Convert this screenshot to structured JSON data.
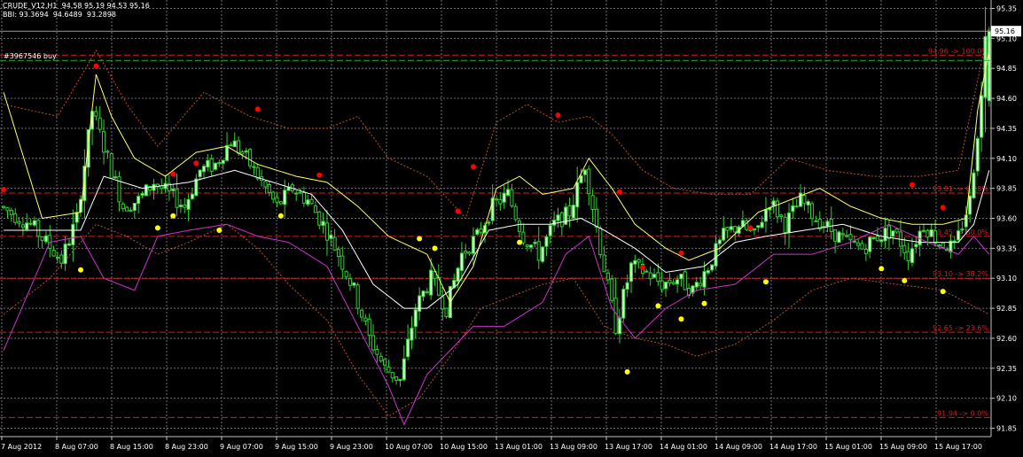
{
  "header": {
    "symbol_line": "CRUDE_V12,H1  94.58 95.19 94.53 95.16",
    "indicator_line": "BBI: 93.3694  94.6489  93.2898"
  },
  "order_label": "#3967546 buy",
  "current_price_label": "95.16",
  "colors": {
    "background": "#000000",
    "grid": "#707070",
    "candle": "#33cc33",
    "bull_fill": "#ccffcc",
    "fast_ma": "#ffff66",
    "slow_ma": "#ffffff",
    "lower_line": "#cc33cc",
    "envelope": "#b8502a",
    "fibo": "#cc2222",
    "peak_dot": "#ff0000",
    "trough_dot": "#ffff00"
  },
  "chart_data": {
    "type": "candlestick",
    "title": "CRUDE_V12,H1",
    "timeframe": "H1",
    "ylim": [
      91.78,
      95.42
    ],
    "y_ticks": [
      "95.35",
      "95.10",
      "94.85",
      "94.60",
      "94.35",
      "94.10",
      "93.85",
      "93.60",
      "93.35",
      "93.10",
      "92.85",
      "92.60",
      "92.35",
      "92.10",
      "91.85"
    ],
    "x_ticks": [
      "7 Aug 2012",
      "8 Aug 07:00",
      "8 Aug 15:00",
      "8 Aug 23:00",
      "9 Aug 07:00",
      "9 Aug 15:00",
      "9 Aug 23:00",
      "10 Aug 07:00",
      "10 Aug 15:00",
      "13 Aug 01:00",
      "13 Aug 09:00",
      "13 Aug 17:00",
      "14 Aug 01:00",
      "14 Aug 09:00",
      "14 Aug 17:00",
      "15 Aug 01:00",
      "15 Aug 09:00",
      "15 Aug 17:00"
    ],
    "last_ohlc": {
      "open": 94.58,
      "high": 95.19,
      "low": 94.53,
      "close": 95.16
    },
    "bbi": [
      93.3694,
      94.6489,
      93.2898
    ],
    "fibo_levels": [
      {
        "label": "94.96 -> 100.0%",
        "price": 94.96
      },
      {
        "label": "93.81 -> 61.8%",
        "price": 93.81
      },
      {
        "label": "93.45 -> 50.0%",
        "price": 93.45
      },
      {
        "label": "93.10 -> 38.2%",
        "price": 93.1
      },
      {
        "label": "92.65 -> 23.6%",
        "price": 92.65
      },
      {
        "label": "91.94 -> 0.0%",
        "price": 91.94
      }
    ],
    "candles_anchor": [
      [
        0,
        93.7
      ],
      [
        8,
        93.55
      ],
      [
        12,
        93.4
      ],
      [
        16,
        93.25
      ],
      [
        20,
        93.6
      ],
      [
        24,
        94.5
      ],
      [
        28,
        94.1
      ],
      [
        32,
        93.7
      ],
      [
        36,
        93.75
      ],
      [
        40,
        93.9
      ],
      [
        44,
        93.8
      ],
      [
        48,
        93.7
      ],
      [
        52,
        94.0
      ],
      [
        56,
        94.05
      ],
      [
        60,
        94.25
      ],
      [
        64,
        94.1
      ],
      [
        68,
        93.9
      ],
      [
        72,
        93.7
      ],
      [
        76,
        93.85
      ],
      [
        80,
        93.75
      ],
      [
        84,
        93.55
      ],
      [
        88,
        93.3
      ],
      [
        92,
        93.0
      ],
      [
        96,
        92.6
      ],
      [
        100,
        92.35
      ],
      [
        104,
        92.25
      ],
      [
        108,
        92.85
      ],
      [
        112,
        93.1
      ],
      [
        116,
        92.85
      ],
      [
        120,
        93.3
      ],
      [
        124,
        93.45
      ],
      [
        128,
        93.7
      ],
      [
        132,
        93.8
      ],
      [
        136,
        93.45
      ],
      [
        140,
        93.3
      ],
      [
        144,
        93.55
      ],
      [
        148,
        93.65
      ],
      [
        152,
        94.05
      ],
      [
        156,
        93.35
      ],
      [
        160,
        92.7
      ],
      [
        164,
        93.2
      ],
      [
        168,
        93.15
      ],
      [
        172,
        93.05
      ],
      [
        176,
        93.1
      ],
      [
        180,
        93.0
      ],
      [
        184,
        93.2
      ],
      [
        188,
        93.45
      ],
      [
        192,
        93.55
      ],
      [
        196,
        93.45
      ],
      [
        200,
        93.75
      ],
      [
        204,
        93.55
      ],
      [
        208,
        93.75
      ],
      [
        212,
        93.6
      ],
      [
        216,
        93.5
      ],
      [
        220,
        93.4
      ],
      [
        224,
        93.35
      ],
      [
        228,
        93.45
      ],
      [
        232,
        93.5
      ],
      [
        236,
        93.3
      ],
      [
        240,
        93.55
      ],
      [
        244,
        93.4
      ],
      [
        248,
        93.35
      ],
      [
        252,
        93.75
      ],
      [
        255,
        94.6
      ],
      [
        256,
        95.16
      ]
    ],
    "fast_ma_anchor": [
      [
        0,
        94.65
      ],
      [
        10,
        93.6
      ],
      [
        20,
        93.65
      ],
      [
        24,
        94.8
      ],
      [
        28,
        94.45
      ],
      [
        34,
        94.1
      ],
      [
        42,
        93.95
      ],
      [
        50,
        94.15
      ],
      [
        58,
        94.2
      ],
      [
        66,
        94.05
      ],
      [
        76,
        93.95
      ],
      [
        84,
        93.9
      ],
      [
        92,
        93.7
      ],
      [
        100,
        93.45
      ],
      [
        110,
        93.3
      ],
      [
        116,
        92.9
      ],
      [
        122,
        93.2
      ],
      [
        128,
        93.85
      ],
      [
        134,
        93.95
      ],
      [
        140,
        93.8
      ],
      [
        148,
        93.85
      ],
      [
        152,
        94.1
      ],
      [
        158,
        93.85
      ],
      [
        164,
        93.55
      ],
      [
        172,
        93.35
      ],
      [
        178,
        93.25
      ],
      [
        186,
        93.35
      ],
      [
        196,
        93.65
      ],
      [
        204,
        93.75
      ],
      [
        212,
        93.85
      ],
      [
        220,
        93.7
      ],
      [
        228,
        93.6
      ],
      [
        236,
        93.55
      ],
      [
        244,
        93.55
      ],
      [
        250,
        93.6
      ],
      [
        253,
        94.5
      ],
      [
        256,
        95.0
      ]
    ],
    "slow_ma_anchor": [
      [
        0,
        93.5
      ],
      [
        20,
        93.5
      ],
      [
        26,
        93.95
      ],
      [
        36,
        93.85
      ],
      [
        48,
        93.9
      ],
      [
        60,
        94.0
      ],
      [
        70,
        93.9
      ],
      [
        80,
        93.8
      ],
      [
        88,
        93.5
      ],
      [
        96,
        93.05
      ],
      [
        104,
        92.85
      ],
      [
        110,
        92.85
      ],
      [
        118,
        93.05
      ],
      [
        126,
        93.5
      ],
      [
        134,
        93.55
      ],
      [
        142,
        93.55
      ],
      [
        150,
        93.6
      ],
      [
        156,
        93.5
      ],
      [
        164,
        93.35
      ],
      [
        172,
        93.15
      ],
      [
        182,
        93.2
      ],
      [
        190,
        93.4
      ],
      [
        198,
        93.45
      ],
      [
        208,
        93.5
      ],
      [
        218,
        93.55
      ],
      [
        228,
        93.45
      ],
      [
        238,
        93.4
      ],
      [
        248,
        93.4
      ],
      [
        252,
        93.55
      ],
      [
        256,
        94.0
      ]
    ],
    "lower_line_anchor": [
      [
        0,
        92.5
      ],
      [
        6,
        92.95
      ],
      [
        12,
        93.4
      ],
      [
        20,
        93.45
      ],
      [
        26,
        93.1
      ],
      [
        34,
        93.0
      ],
      [
        40,
        93.45
      ],
      [
        48,
        93.5
      ],
      [
        58,
        93.55
      ],
      [
        66,
        93.45
      ],
      [
        74,
        93.4
      ],
      [
        84,
        93.2
      ],
      [
        92,
        92.7
      ],
      [
        100,
        92.2
      ],
      [
        104,
        91.88
      ],
      [
        110,
        92.3
      ],
      [
        116,
        92.5
      ],
      [
        122,
        92.7
      ],
      [
        130,
        92.7
      ],
      [
        140,
        92.9
      ],
      [
        146,
        93.3
      ],
      [
        152,
        93.45
      ],
      [
        158,
        92.85
      ],
      [
        164,
        92.6
      ],
      [
        172,
        92.85
      ],
      [
        180,
        93.0
      ],
      [
        190,
        93.05
      ],
      [
        200,
        93.3
      ],
      [
        210,
        93.3
      ],
      [
        220,
        93.4
      ],
      [
        230,
        93.55
      ],
      [
        240,
        93.4
      ],
      [
        248,
        93.3
      ],
      [
        252,
        93.45
      ],
      [
        256,
        93.3
      ]
    ],
    "envelope_upper_anchor": [
      [
        0,
        94.55
      ],
      [
        14,
        94.45
      ],
      [
        24,
        95.0
      ],
      [
        32,
        94.55
      ],
      [
        40,
        94.2
      ],
      [
        52,
        94.65
      ],
      [
        64,
        94.45
      ],
      [
        74,
        94.35
      ],
      [
        84,
        94.35
      ],
      [
        92,
        94.45
      ],
      [
        100,
        94.1
      ],
      [
        110,
        93.95
      ],
      [
        120,
        93.6
      ],
      [
        128,
        94.4
      ],
      [
        136,
        94.55
      ],
      [
        144,
        94.4
      ],
      [
        152,
        94.45
      ],
      [
        158,
        94.3
      ],
      [
        166,
        94.0
      ],
      [
        174,
        93.85
      ],
      [
        184,
        93.8
      ],
      [
        194,
        93.8
      ],
      [
        204,
        94.1
      ],
      [
        214,
        94.0
      ],
      [
        226,
        93.95
      ],
      [
        238,
        93.95
      ],
      [
        248,
        94.0
      ],
      [
        256,
        95.2
      ]
    ],
    "envelope_lower_anchor": [
      [
        0,
        92.8
      ],
      [
        12,
        93.1
      ],
      [
        24,
        93.55
      ],
      [
        32,
        93.45
      ],
      [
        40,
        93.3
      ],
      [
        48,
        93.4
      ],
      [
        58,
        93.55
      ],
      [
        66,
        93.35
      ],
      [
        74,
        93.05
      ],
      [
        84,
        92.75
      ],
      [
        92,
        92.3
      ],
      [
        100,
        91.95
      ],
      [
        108,
        92.1
      ],
      [
        116,
        92.45
      ],
      [
        124,
        92.85
      ],
      [
        132,
        92.95
      ],
      [
        140,
        93.05
      ],
      [
        148,
        93.1
      ],
      [
        156,
        92.7
      ],
      [
        164,
        92.6
      ],
      [
        172,
        92.55
      ],
      [
        180,
        92.45
      ],
      [
        190,
        92.55
      ],
      [
        200,
        92.75
      ],
      [
        210,
        93.0
      ],
      [
        220,
        93.1
      ],
      [
        232,
        93.05
      ],
      [
        244,
        93.0
      ],
      [
        256,
        92.8
      ]
    ],
    "peak_dots": [
      [
        0,
        93.84
      ],
      [
        24,
        94.87
      ],
      [
        44,
        93.97
      ],
      [
        50,
        94.06
      ],
      [
        66,
        94.51
      ],
      [
        82,
        93.96
      ],
      [
        118,
        93.66
      ],
      [
        122,
        94.03
      ],
      [
        144,
        94.46
      ],
      [
        160,
        93.82
      ],
      [
        166,
        93.19
      ],
      [
        176,
        93.31
      ],
      [
        194,
        93.52
      ],
      [
        236,
        93.88
      ],
      [
        244,
        93.69
      ]
    ],
    "trough_dots": [
      [
        20,
        93.17
      ],
      [
        40,
        93.52
      ],
      [
        44,
        93.62
      ],
      [
        56,
        93.5
      ],
      [
        72,
        93.62
      ],
      [
        108,
        93.43
      ],
      [
        112,
        93.35
      ],
      [
        134,
        93.4
      ],
      [
        162,
        92.32
      ],
      [
        170,
        92.87
      ],
      [
        176,
        92.76
      ],
      [
        182,
        92.89
      ],
      [
        198,
        93.07
      ],
      [
        228,
        93.18
      ],
      [
        234,
        93.08
      ],
      [
        244,
        92.99
      ]
    ]
  }
}
